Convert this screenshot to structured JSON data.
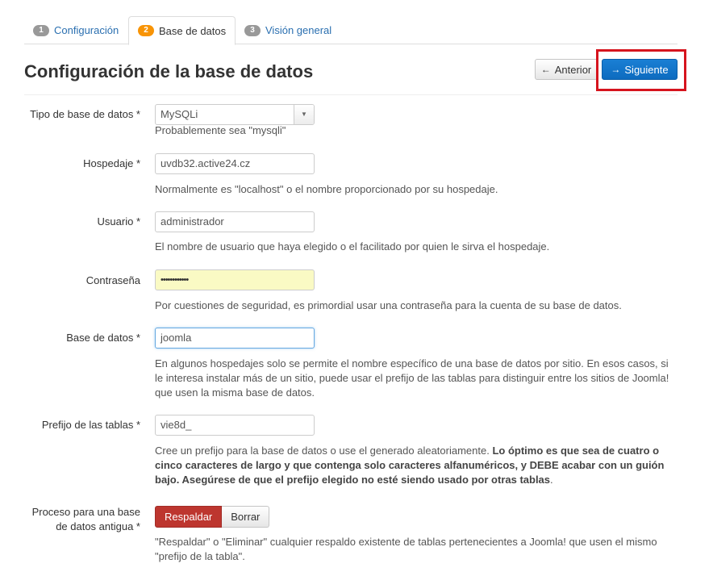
{
  "tabs": [
    {
      "number": "1",
      "label": "Configuración"
    },
    {
      "number": "2",
      "label": "Base de datos"
    },
    {
      "number": "3",
      "label": "Visión general"
    }
  ],
  "header": {
    "title": "Configuración de la base de datos",
    "prev_label": "Anterior",
    "next_label": "Siguiente",
    "prev_icon": "arrow-left-icon",
    "next_icon": "arrow-right-icon"
  },
  "colors": {
    "primary": "#0d6bbf",
    "danger": "#bd362f",
    "highlight": "#d6141e",
    "badge_active": "#f89406"
  },
  "form": {
    "db_type": {
      "label": "Tipo de base de datos *",
      "value": "MySQLi",
      "help": "Probablemente sea \"mysqli\""
    },
    "host": {
      "label": "Hospedaje *",
      "value": "uvdb32.active24.cz",
      "help": "Normalmente es \"localhost\" o el nombre proporcionado por su hospedaje."
    },
    "user": {
      "label": "Usuario *",
      "value": "administrador",
      "help": "El nombre de usuario que haya elegido o el facilitado por quien le sirva el hospedaje."
    },
    "password": {
      "label": "Contraseña",
      "value": "••••••••••••",
      "help": "Por cuestiones de seguridad, es primordial usar una contraseña para la cuenta de su base de datos."
    },
    "db_name": {
      "label": "Base de datos *",
      "value": "joomla",
      "help": "En algunos hospedajes solo se permite el nombre específico de una base de datos por sitio. En esos casos, si le interesa instalar más de un sitio, puede usar el prefijo de las tablas para distinguir entre los sitios de Joomla! que usen la misma base de datos."
    },
    "prefix": {
      "label": "Prefijo de las tablas *",
      "value": "vie8d_",
      "help_plain": "Cree un prefijo para la base de datos o use el generado aleatoriamente.",
      "help_bold": "Lo óptimo es que sea de cuatro o cinco caracteres de largo y que contenga solo caracteres alfanuméricos, y DEBE acabar con un guión bajo. Asegúrese de que el prefijo elegido no esté siendo usado por otras tablas"
    },
    "old_db": {
      "label_line1": "Proceso para una base",
      "label_line2": "de datos antigua *",
      "backup_label": "Respaldar",
      "remove_label": "Borrar",
      "help": "\"Respaldar\" o \"Eliminar\" cualquier respaldo existente de tablas pertenecientes a Joomla! que usen el mismo \"prefijo de la tabla\"."
    }
  }
}
